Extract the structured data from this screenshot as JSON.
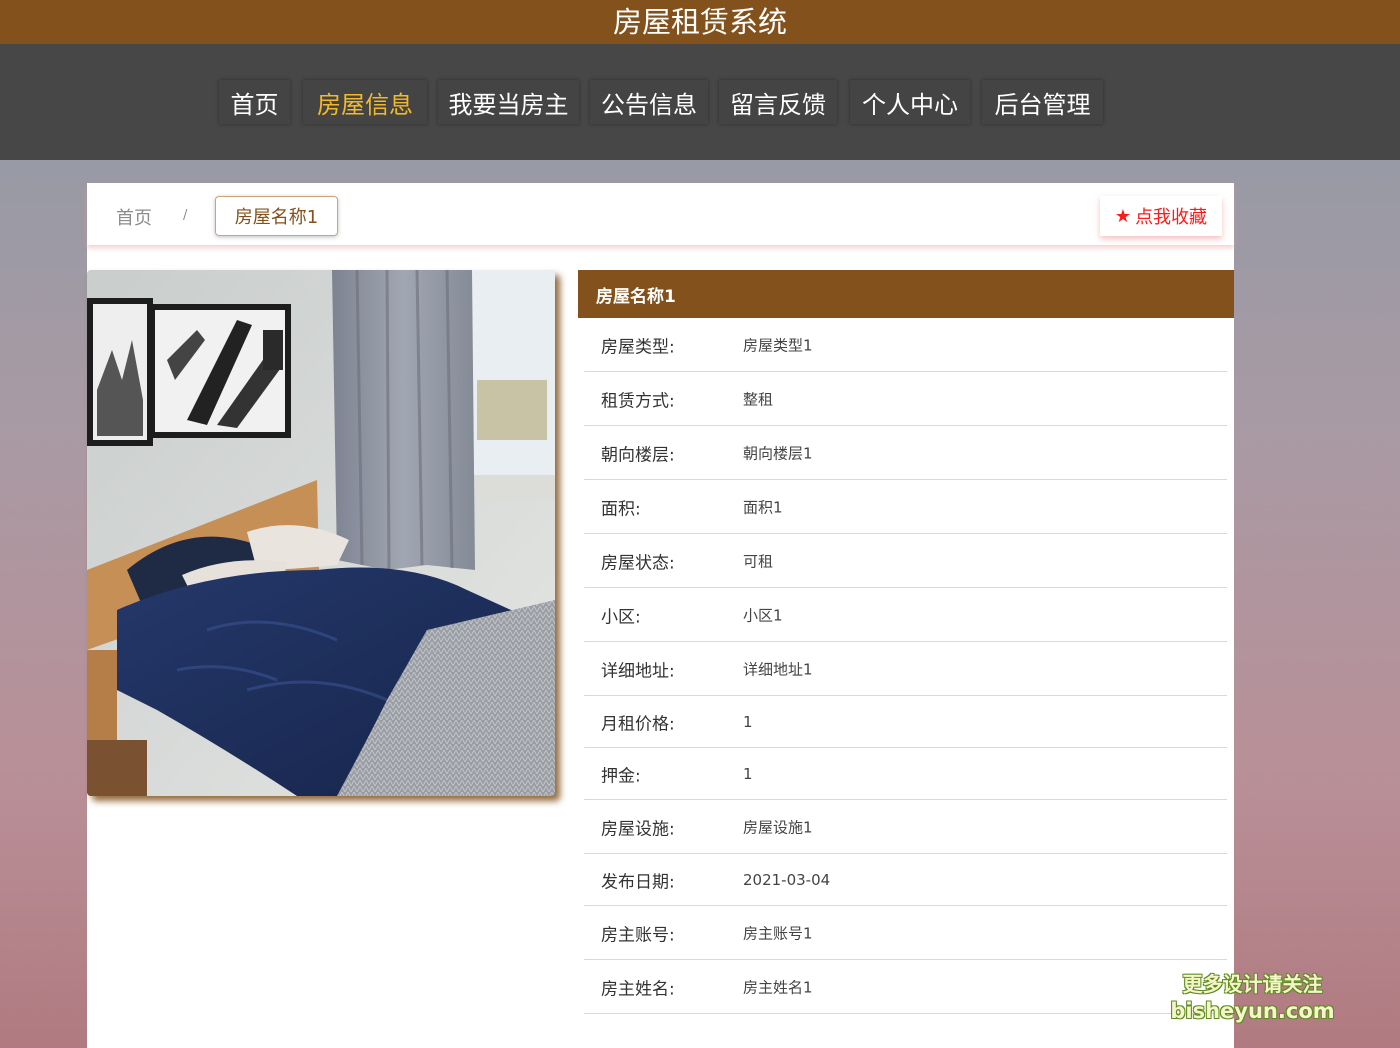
{
  "app": {
    "title": "房屋租赁系统"
  },
  "nav": {
    "items": [
      {
        "label": "首页"
      },
      {
        "label": "房屋信息"
      },
      {
        "label": "我要当房主"
      },
      {
        "label": "公告信息"
      },
      {
        "label": "留言反馈"
      },
      {
        "label": "个人中心"
      },
      {
        "label": "后台管理"
      }
    ],
    "active": "房屋信息",
    "active_color": "#f2b92a"
  },
  "breadcrumb": {
    "home": "首页",
    "separator": "/",
    "current": "房屋名称1"
  },
  "favorite": {
    "icon": "star-icon",
    "label": "点我收藏",
    "color": "#ff1a1a"
  },
  "house": {
    "name": "房屋名称1",
    "fields": [
      {
        "label": "房屋类型:",
        "value": "房屋类型1"
      },
      {
        "label": "租赁方式:",
        "value": "整租"
      },
      {
        "label": "朝向楼层:",
        "value": "朝向楼层1"
      },
      {
        "label": "面积:",
        "value": "面积1"
      },
      {
        "label": "房屋状态:",
        "value": "可租"
      },
      {
        "label": "小区:",
        "value": "小区1"
      },
      {
        "label": "详细地址:",
        "value": "详细地址1"
      },
      {
        "label": "月租价格:",
        "value": "1"
      },
      {
        "label": "押金:",
        "value": "1"
      },
      {
        "label": "房屋设施:",
        "value": "房屋设施1"
      },
      {
        "label": "发布日期:",
        "value": "2021-03-04"
      },
      {
        "label": "房主账号:",
        "value": "房主账号1"
      },
      {
        "label": "房主姓名:",
        "value": "房主姓名1"
      }
    ]
  },
  "theme": {
    "brand": "#83511b",
    "nav_bg": "#474747"
  },
  "watermark": {
    "line1": "更多设计请关注",
    "line2": "bisheyun.com"
  }
}
